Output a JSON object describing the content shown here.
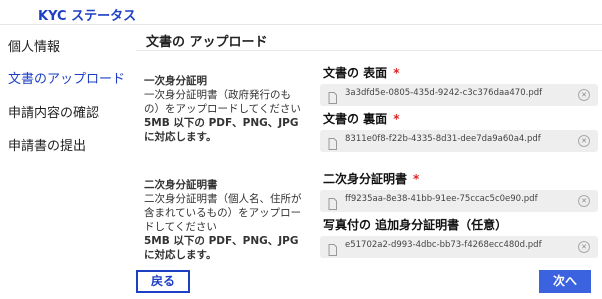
{
  "app": {
    "title": "KYC ステータス"
  },
  "sidebar": {
    "items": [
      {
        "label": "個人情報",
        "active": false
      },
      {
        "label": "文書のアップロード",
        "active": true
      },
      {
        "label": "申請内容の確認",
        "active": false
      },
      {
        "label": "申請書の提出",
        "active": false
      }
    ]
  },
  "main": {
    "section_title": "文書の アップロード",
    "primary": {
      "heading": "一次身分証明",
      "description": "一次身分証明書（政府発行のもの）をアップロードしてください",
      "formats": "5MB 以下の PDF、PNG、JPG に対応します。",
      "front_label": "文書の 表面",
      "front_file": "3a3dfd5e-0805-435d-9242-c3c376daa470.pdf",
      "back_label": "文書の 裏面",
      "back_file": "8311e0f8-f22b-4335-8d31-dee7da9a60a4.pdf"
    },
    "secondary": {
      "heading": "二次身分証明書",
      "description": "二次身分証明書（個人名、住所が含まれているもの）をアップロードしてください",
      "formats": "5MB 以下の PDF、PNG、JPG に対応します。",
      "doc_label": "二次身分証明書",
      "doc_file": "ff9235aa-8e38-41bb-91ee-75ccac5c0e90.pdf",
      "extra_label": "写真付の 追加身分証明書（任意）",
      "extra_file": "e51702a2-d993-4dbc-bb73-f4268ecc480d.pdf"
    },
    "required_mark": "*"
  },
  "footer": {
    "back_label": "戻る",
    "next_label": "次へ"
  },
  "colors": {
    "accent": "#1d3fc4",
    "button": "#3b63e0",
    "required": "#e02424"
  }
}
